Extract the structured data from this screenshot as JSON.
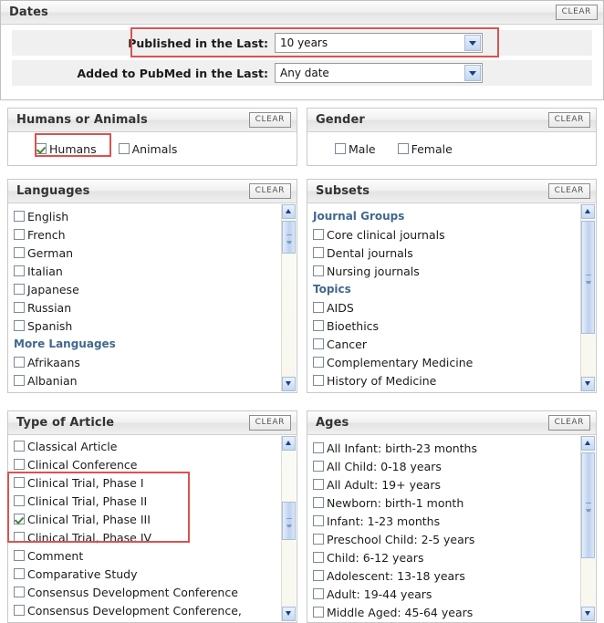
{
  "dates": {
    "title": "Dates",
    "clear_label": "CLEAR",
    "rows": [
      {
        "label": "Published in the Last:",
        "value": "10 years",
        "arrow_icon": "chevron-down-icon"
      },
      {
        "label": "Added to PubMed in the Last:",
        "value": "Any date",
        "arrow_icon": "chevron-down-icon"
      }
    ]
  },
  "humans_or_animals": {
    "title": "Humans or Animals",
    "clear_label": "CLEAR",
    "items": [
      {
        "label": "Humans",
        "checked": true
      },
      {
        "label": "Animals",
        "checked": false
      }
    ]
  },
  "gender": {
    "title": "Gender",
    "clear_label": "CLEAR",
    "items": [
      {
        "label": "Male",
        "checked": false
      },
      {
        "label": "Female",
        "checked": false
      }
    ]
  },
  "languages": {
    "title": "Languages",
    "clear_label": "CLEAR",
    "items": [
      {
        "label": "English",
        "checked": false
      },
      {
        "label": "French",
        "checked": false
      },
      {
        "label": "German",
        "checked": false
      },
      {
        "label": "Italian",
        "checked": false
      },
      {
        "label": "Japanese",
        "checked": false
      },
      {
        "label": "Russian",
        "checked": false
      },
      {
        "label": "Spanish",
        "checked": false
      },
      {
        "group": "More Languages"
      },
      {
        "label": "Afrikaans",
        "checked": false
      },
      {
        "label": "Albanian",
        "checked": false
      }
    ]
  },
  "subsets": {
    "title": "Subsets",
    "clear_label": "CLEAR",
    "items": [
      {
        "group": "Journal Groups"
      },
      {
        "label": "Core clinical journals",
        "checked": false
      },
      {
        "label": "Dental journals",
        "checked": false
      },
      {
        "label": "Nursing journals",
        "checked": false
      },
      {
        "group": "Topics"
      },
      {
        "label": "AIDS",
        "checked": false
      },
      {
        "label": "Bioethics",
        "checked": false
      },
      {
        "label": "Cancer",
        "checked": false
      },
      {
        "label": "Complementary Medicine",
        "checked": false
      },
      {
        "label": "History of Medicine",
        "checked": false
      }
    ]
  },
  "type_of_article": {
    "title": "Type of Article",
    "clear_label": "CLEAR",
    "items": [
      {
        "label": "Classical Article",
        "checked": false
      },
      {
        "label": "Clinical Conference",
        "checked": false
      },
      {
        "label": "Clinical Trial, Phase I",
        "checked": false
      },
      {
        "label": "Clinical Trial, Phase II",
        "checked": false
      },
      {
        "label": "Clinical Trial, Phase III",
        "checked": true
      },
      {
        "label": "Clinical Trial, Phase IV",
        "checked": false
      },
      {
        "label": "Comment",
        "checked": false
      },
      {
        "label": "Comparative Study",
        "checked": false
      },
      {
        "label": "Consensus Development Conference",
        "checked": false
      },
      {
        "label": "Consensus Development Conference,",
        "checked": false
      }
    ]
  },
  "ages": {
    "title": "Ages",
    "clear_label": "CLEAR",
    "items": [
      {
        "label": "All Infant: birth-23 months",
        "checked": false
      },
      {
        "label": "All Child: 0-18 years",
        "checked": false
      },
      {
        "label": "All Adult: 19+ years",
        "checked": false
      },
      {
        "label": "Newborn: birth-1 month",
        "checked": false
      },
      {
        "label": "Infant: 1-23 months",
        "checked": false
      },
      {
        "label": "Preschool Child: 2-5 years",
        "checked": false
      },
      {
        "label": "Child: 6-12 years",
        "checked": false
      },
      {
        "label": "Adolescent: 13-18 years",
        "checked": false
      },
      {
        "label": "Adult: 19-44 years",
        "checked": false
      },
      {
        "label": "Middle Aged: 45-64 years",
        "checked": false
      }
    ]
  },
  "highlights": {
    "color": "#d9534f",
    "published_in_the_last": "Published in the Last:",
    "humans": "Humans",
    "clinical_trial_phases": "Clinical Trial, Phase I-IV"
  }
}
